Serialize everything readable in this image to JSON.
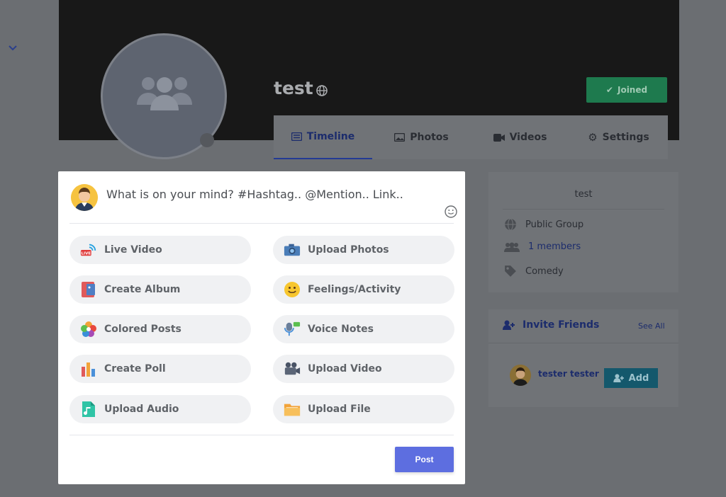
{
  "group": {
    "name": "test",
    "joined_label": "Joined",
    "tabs": [
      {
        "label": "Timeline",
        "icon": "list-icon",
        "active": true
      },
      {
        "label": "Photos",
        "icon": "image-icon"
      },
      {
        "label": "Videos",
        "icon": "video-camera-icon"
      },
      {
        "label": "Settings",
        "icon": "gear-icon"
      }
    ]
  },
  "info": {
    "title": "test",
    "privacy": "Public Group",
    "members": "1 members",
    "category": "Comedy"
  },
  "invite": {
    "title": "Invite Friends",
    "see_all": "See All",
    "friend_name": "tester tester",
    "add_label": "Add"
  },
  "composer": {
    "placeholder": "What is on your mind? #Hashtag.. @Mention.. Link..",
    "options": [
      {
        "label": "Live Video",
        "icon": "live-video-icon"
      },
      {
        "label": "Upload Photos",
        "icon": "camera-icon"
      },
      {
        "label": "Create Album",
        "icon": "album-icon"
      },
      {
        "label": "Feelings/Activity",
        "icon": "smiley-icon"
      },
      {
        "label": "Colored Posts",
        "icon": "color-petals-icon"
      },
      {
        "label": "Voice Notes",
        "icon": "microphone-icon"
      },
      {
        "label": "Create Poll",
        "icon": "poll-icon"
      },
      {
        "label": "Upload Video",
        "icon": "video-camera-icon"
      },
      {
        "label": "Upload Audio",
        "icon": "music-file-icon"
      },
      {
        "label": "Upload File",
        "icon": "folder-icon"
      }
    ],
    "post_label": "Post"
  },
  "colors": {
    "overlay_bg": "#6b6e72",
    "accent": "#5d6ee0",
    "joined": "#1e7a4e",
    "link": "#1c2c6c"
  }
}
